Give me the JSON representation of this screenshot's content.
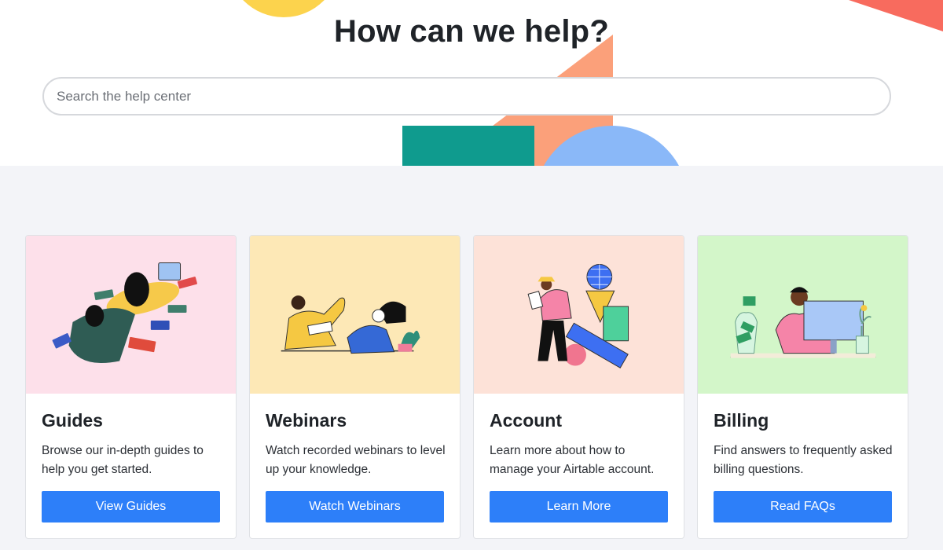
{
  "hero": {
    "title": "How can we help?",
    "search_placeholder": "Search the help center"
  },
  "cards": [
    {
      "title": "Guides",
      "description": "Browse our in-depth guides to help you get started.",
      "button": "View Guides",
      "bg_color": "#fde0ea",
      "illustration": "person-reading-books-illustration"
    },
    {
      "title": "Webinars",
      "description": "Watch recorded webinars to level up your knowledge.",
      "button": "Watch Webinars",
      "bg_color": "#fde8b6",
      "illustration": "people-celebrating-illustration"
    },
    {
      "title": "Account",
      "description": "Learn more about how to manage your Airtable account.",
      "button": "Learn More",
      "bg_color": "#fde2d8",
      "illustration": "person-with-shapes-illustration"
    },
    {
      "title": "Billing",
      "description": "Find answers to frequently asked billing questions.",
      "button": "Read FAQs",
      "bg_color": "#d3f6c9",
      "illustration": "person-at-computer-money-illustration"
    }
  ],
  "colors": {
    "accent": "#2d7ff9",
    "page_bg": "#f3f4f8"
  }
}
